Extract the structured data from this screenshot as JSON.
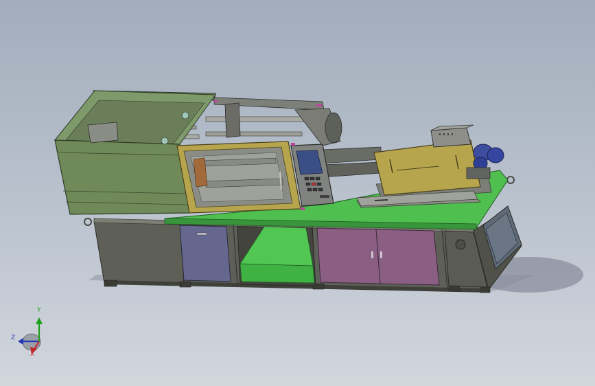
{
  "viewport": {
    "background_top": "#a2acbb",
    "background_bottom": "#d2d6dd"
  },
  "colors": {
    "enclosure_green": "#6f8a58",
    "frame_yellow": "#b7a54e",
    "bed_green": "#4fbf4f",
    "base_gray": "#5d5f57",
    "door_blue": "#65668f",
    "door_purple": "#8a5f83",
    "motor_blue": "#3d4da0",
    "accent_magenta": "#c040a0"
  },
  "triad": {
    "y_label": "Y",
    "z_label": "Z",
    "x_label": "X",
    "y_color": "#1ba11b",
    "z_color": "#2339b5",
    "x_color": "#c12a2a"
  }
}
